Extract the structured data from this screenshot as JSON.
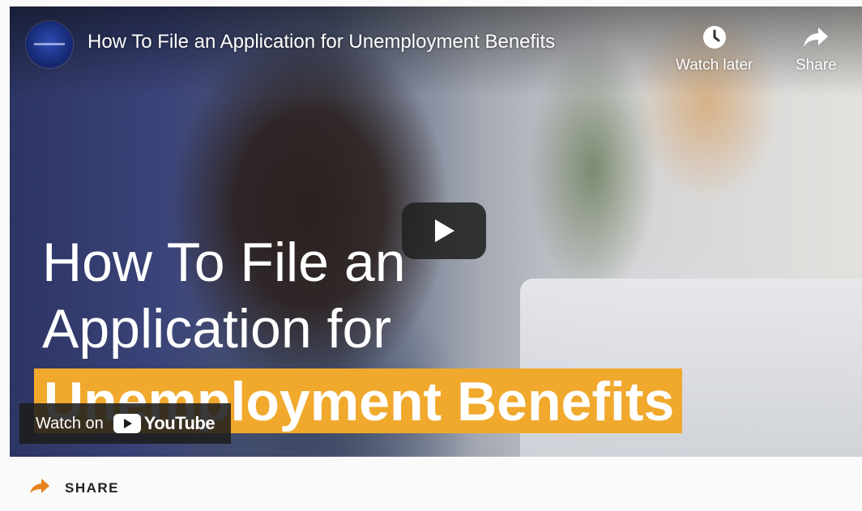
{
  "player": {
    "title": "How To File an Application for Unemployment Benefits",
    "actions": [
      {
        "label": "Watch later",
        "icon": "clock-icon"
      },
      {
        "label": "Share",
        "icon": "share-arrow-icon"
      }
    ],
    "play_icon": "play-icon",
    "thumbnail_text": {
      "line1": "How To File an",
      "line2": "Application for",
      "line3": "Unemployment Benefits"
    },
    "watch_on": {
      "label": "Watch on",
      "brand": "YouTube"
    }
  },
  "share_bar": {
    "label": "SHARE",
    "icon": "share-arrow-icon"
  },
  "colors": {
    "highlight": "#f0a92d",
    "share_icon": "#e8821e",
    "youtube_red": "#ff0000"
  }
}
